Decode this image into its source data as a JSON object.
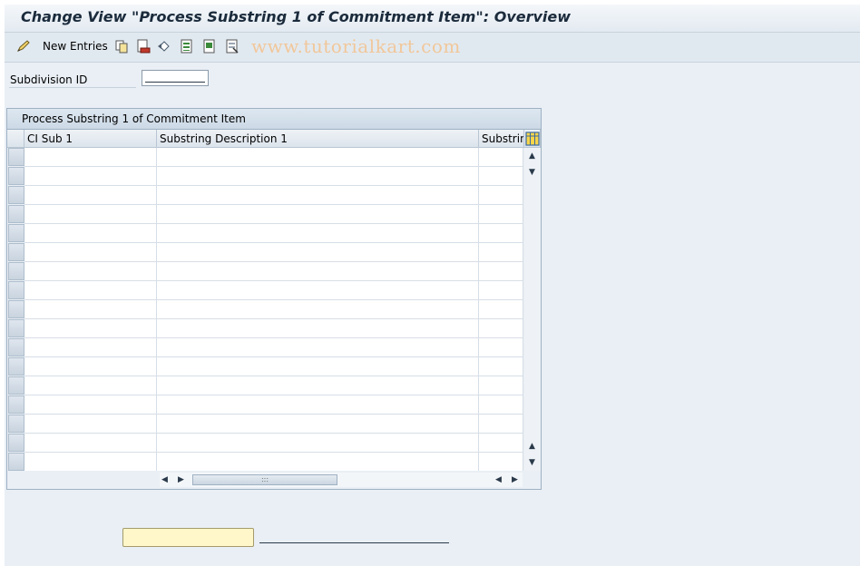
{
  "window": {
    "title": "Change View \"Process Substring 1 of Commitment Item\": Overview"
  },
  "toolbar": {
    "items": [
      {
        "icon": "edit-pencil-icon"
      },
      {
        "label": "New Entries"
      },
      {
        "icon": "copy-icon"
      },
      {
        "icon": "delete-icon"
      },
      {
        "icon": "undo-change-icon"
      },
      {
        "icon": "select-all-icon"
      },
      {
        "icon": "select-block-icon"
      },
      {
        "icon": "deselect-all-icon"
      }
    ],
    "watermark": "www.tutorialkart.com"
  },
  "filter": {
    "label": "Subdivision ID",
    "value": ""
  },
  "table": {
    "title": "Process Substring 1 of Commitment Item",
    "columns": [
      "CI Sub 1",
      "Substring Description 1",
      "Substring"
    ],
    "rows": [
      [
        "",
        "",
        ""
      ],
      [
        "",
        "",
        ""
      ],
      [
        "",
        "",
        ""
      ],
      [
        "",
        "",
        ""
      ],
      [
        "",
        "",
        ""
      ],
      [
        "",
        "",
        ""
      ],
      [
        "",
        "",
        ""
      ],
      [
        "",
        "",
        ""
      ],
      [
        "",
        "",
        ""
      ],
      [
        "",
        "",
        ""
      ],
      [
        "",
        "",
        ""
      ],
      [
        "",
        "",
        ""
      ],
      [
        "",
        "",
        ""
      ],
      [
        "",
        "",
        ""
      ],
      [
        "",
        "",
        ""
      ],
      [
        "",
        "",
        ""
      ],
      [
        "",
        "",
        ""
      ]
    ],
    "column_settings_icon": "table-settings-icon"
  },
  "position_field": {
    "value": ""
  },
  "colors": {
    "background": "#e9eff5",
    "watermark": "#f1c79a",
    "position_input": "#fff7c9"
  }
}
